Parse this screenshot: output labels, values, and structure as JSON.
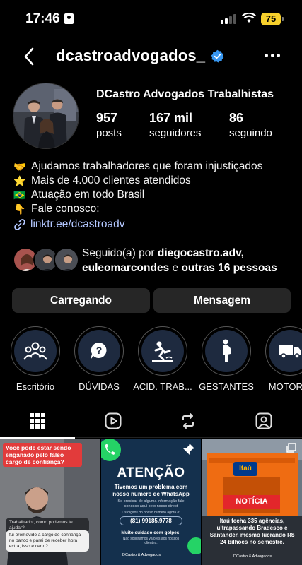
{
  "status": {
    "time": "17:46",
    "battery": "75"
  },
  "header": {
    "username": "dcastroadvogados_"
  },
  "profile": {
    "display_name": "DCastro Advogados Trabalhistas",
    "stats": [
      {
        "value": "957",
        "label": "posts"
      },
      {
        "value": "167 mil",
        "label": "seguidores"
      },
      {
        "value": "86",
        "label": "seguindo"
      }
    ],
    "bio": [
      {
        "emoji": "🤝",
        "text": "Ajudamos trabalhadores que foram injustiçados"
      },
      {
        "emoji": "⭐",
        "text": "Mais de 4.000 clientes atendidos"
      },
      {
        "emoji": "🇧🇷",
        "text": "Atuação em todo Brasil"
      },
      {
        "emoji": "👇",
        "text": "Fale conosco:"
      }
    ],
    "link": "linktr.ee/dcastroadv"
  },
  "followed_by": {
    "prefix": "Seguido(a) por",
    "user1": "diegocastro.adv,",
    "user2": "euleomarcondes",
    "connector": "e",
    "others": "outras 16 pessoas"
  },
  "actions": {
    "primary": "Carregando",
    "secondary": "Mensagem"
  },
  "highlights": [
    {
      "label": "Escritório",
      "icon": "people-group-icon"
    },
    {
      "label": "DÚVIDAS",
      "icon": "question-bubble-icon"
    },
    {
      "label": "ACID. TRAB...",
      "icon": "falling-person-icon"
    },
    {
      "label": "GESTANTES",
      "icon": "pregnant-icon"
    },
    {
      "label": "MOTORIS",
      "icon": "truck-icon"
    }
  ],
  "tabs": [
    "grid-icon",
    "reels-icon",
    "reposts-icon",
    "tagged-icon"
  ],
  "posts": [
    {
      "headline": "Você pode estar sendo enganado pelo falso cargo de confiança?",
      "bubble1": "Trabalhador, como podemos te ajudar?",
      "bubble2": "fui promovido a cargo de confiança no banco e parei de receber hora extra, isso é certo?"
    },
    {
      "title": "ATENÇÃO",
      "subtitle": "Tivemos um problema com nosso número de WhatsApp",
      "small": "Se precisar de alguma informação fale conosco aqui pelo nosso direct",
      "phone_label": "Os dígitos do nosso número agora é:",
      "phone": "(81) 99185.9778",
      "warning": "Muito cuidado com golpes!",
      "warning2": "Não solicitamos valores aos nossos clientes.",
      "brand": "DCastro & Advogados"
    },
    {
      "bank": "Itaú",
      "badge": "NOTÍCIA",
      "text": "Itaú fecha 335 agências, ultrapassando Bradesco e Santander, mesmo lucrando R$ 24 bilhões no semestre.",
      "brand": "DCastro & Advogados"
    }
  ],
  "colors": {
    "verified": "#3897f0",
    "link": "#b3c7ff",
    "button_bg": "#262626",
    "battery": "#f7d02c"
  }
}
